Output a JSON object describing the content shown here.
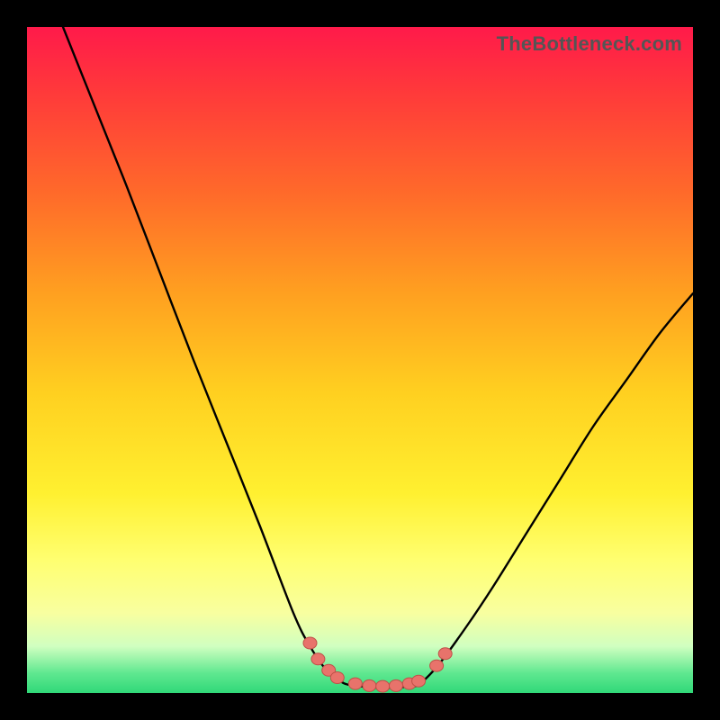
{
  "watermark": "TheBottleneck.com",
  "colors": {
    "frame": "#000000",
    "gradient_top": "#ff1a4a",
    "gradient_bottom": "#30d878",
    "curve": "#000000",
    "marker_fill": "#e8736b",
    "marker_stroke": "#c05048"
  },
  "chart_data": {
    "type": "line",
    "title": "",
    "xlabel": "",
    "ylabel": "",
    "xlim": [
      0,
      100
    ],
    "ylim": [
      0,
      100
    ],
    "grid": false,
    "legend": false,
    "note": "Axes are unlabeled in the source image; values below are normalized 0–100 estimates read from pixel positions (origin bottom-left).",
    "series": [
      {
        "name": "left-branch",
        "x": [
          5.4,
          10,
          15,
          20,
          25,
          30,
          35,
          40,
          42.5,
          45,
          47.5
        ],
        "y": [
          100,
          88.5,
          76,
          63,
          50,
          37.5,
          25,
          12,
          7,
          3.4,
          1.5
        ]
      },
      {
        "name": "valley-floor",
        "x": [
          47.5,
          50,
          52.5,
          55,
          57.5,
          59
        ],
        "y": [
          1.5,
          1.0,
          0.8,
          0.8,
          1.0,
          1.4
        ]
      },
      {
        "name": "right-branch",
        "x": [
          59,
          62,
          66,
          70,
          75,
          80,
          85,
          90,
          95,
          100
        ],
        "y": [
          1.4,
          4.5,
          10,
          16,
          24,
          32,
          40,
          47,
          54,
          60
        ]
      }
    ],
    "markers": {
      "name": "highlighted-points",
      "points": [
        {
          "x": 42.5,
          "y": 7.5
        },
        {
          "x": 43.7,
          "y": 5.1
        },
        {
          "x": 45.3,
          "y": 3.4
        },
        {
          "x": 46.6,
          "y": 2.3
        },
        {
          "x": 49.3,
          "y": 1.4
        },
        {
          "x": 51.4,
          "y": 1.1
        },
        {
          "x": 53.4,
          "y": 1.0
        },
        {
          "x": 55.4,
          "y": 1.1
        },
        {
          "x": 57.4,
          "y": 1.4
        },
        {
          "x": 58.8,
          "y": 1.8
        },
        {
          "x": 61.5,
          "y": 4.1
        },
        {
          "x": 62.8,
          "y": 5.9
        }
      ]
    }
  }
}
